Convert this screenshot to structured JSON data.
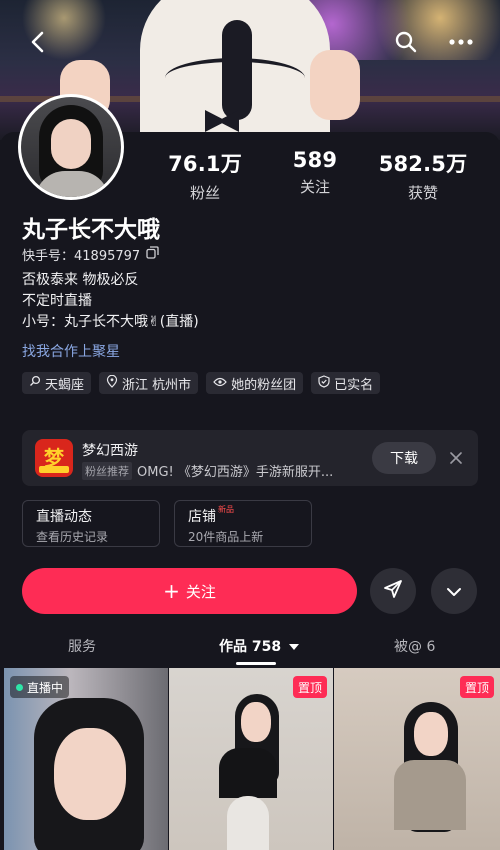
{
  "header": {
    "back_icon": "back-arrow-icon",
    "search_icon": "search-icon",
    "more_icon": "more-dots-icon"
  },
  "profile": {
    "name": "丸子长不大哦",
    "uid": "快手号：41895797",
    "bio": [
      "否极泰来 物极必反",
      "不定时直播",
      "小号：丸子长不大哦✌(直播)"
    ],
    "collab_link": "找我合作上聚星"
  },
  "stats": [
    {
      "value": "76.1万",
      "label": "粉丝"
    },
    {
      "value": "589",
      "label": "关注"
    },
    {
      "value": "582.5万",
      "label": "获赞"
    }
  ],
  "tags": [
    {
      "label": "天蝎座",
      "icon": "zodiac-icon"
    },
    {
      "label": "浙江 杭州市",
      "icon": "location-pin-icon"
    },
    {
      "label": "她的粉丝团",
      "icon": "fan-group-icon"
    },
    {
      "label": "已实名",
      "icon": "verified-shield-icon"
    }
  ],
  "game_ad": {
    "title": "梦幻西游",
    "tag": "粉丝推荐",
    "desc": "OMG! 《梦幻西游》手游新服开...",
    "logo_char": "梦",
    "button": "下载"
  },
  "quick_links": [
    {
      "title": "直播动态",
      "subtitle": "查看历史记录",
      "badge": ""
    },
    {
      "title": "店铺",
      "subtitle": "20件商品上新",
      "badge": "新品"
    }
  ],
  "actions": {
    "follow": "关注",
    "follow_prefix": "+"
  },
  "tabs": [
    {
      "label": "服务"
    },
    {
      "label": "作品 758"
    },
    {
      "label": "被@ 6"
    }
  ],
  "thumbnails": [
    {
      "badge": "直播中",
      "type": "live"
    },
    {
      "badge": "置顶",
      "type": "pinned"
    },
    {
      "badge": "置顶",
      "type": "pinned"
    }
  ],
  "colors": {
    "accent": "#fe2c55",
    "background": "#16161e",
    "link": "#8aa7e2"
  }
}
